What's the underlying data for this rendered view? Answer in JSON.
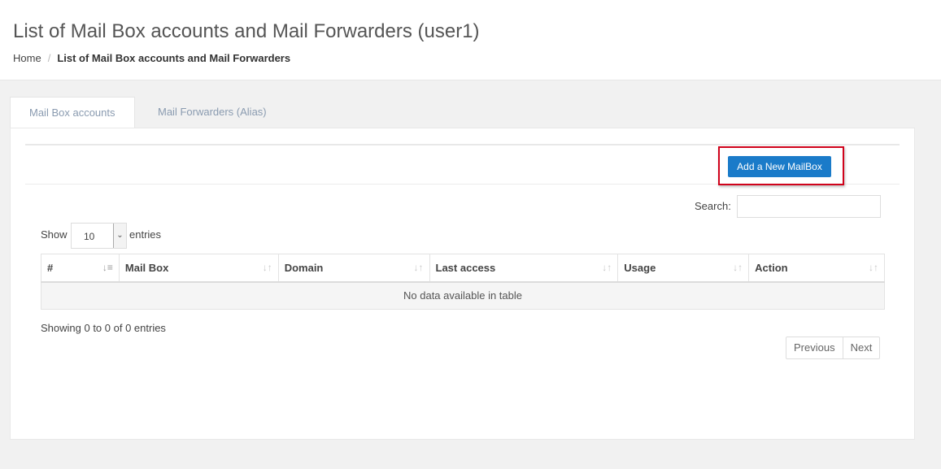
{
  "header": {
    "title": "List of Mail Box accounts and Mail Forwarders (user1)",
    "breadcrumb": {
      "home": "Home",
      "separator": "/",
      "current": "List of Mail Box accounts and Mail Forwarders"
    }
  },
  "tabs": [
    {
      "label": "Mail Box accounts",
      "active": true
    },
    {
      "label": "Mail Forwarders (Alias)",
      "active": false
    }
  ],
  "toolbar": {
    "add_button": "Add a New MailBox"
  },
  "search": {
    "label": "Search:",
    "value": ""
  },
  "length": {
    "show": "Show",
    "value": "10",
    "entries": "entries"
  },
  "table": {
    "columns": [
      "#",
      "Mail Box",
      "Domain",
      "Last access",
      "Usage",
      "Action"
    ],
    "empty": "No data available in table"
  },
  "info": "Showing 0 to 0 of 0 entries",
  "pagination": {
    "previous": "Previous",
    "next": "Next"
  },
  "colors": {
    "primary_button": "#1a7bc9",
    "highlight": "#d0021b"
  }
}
